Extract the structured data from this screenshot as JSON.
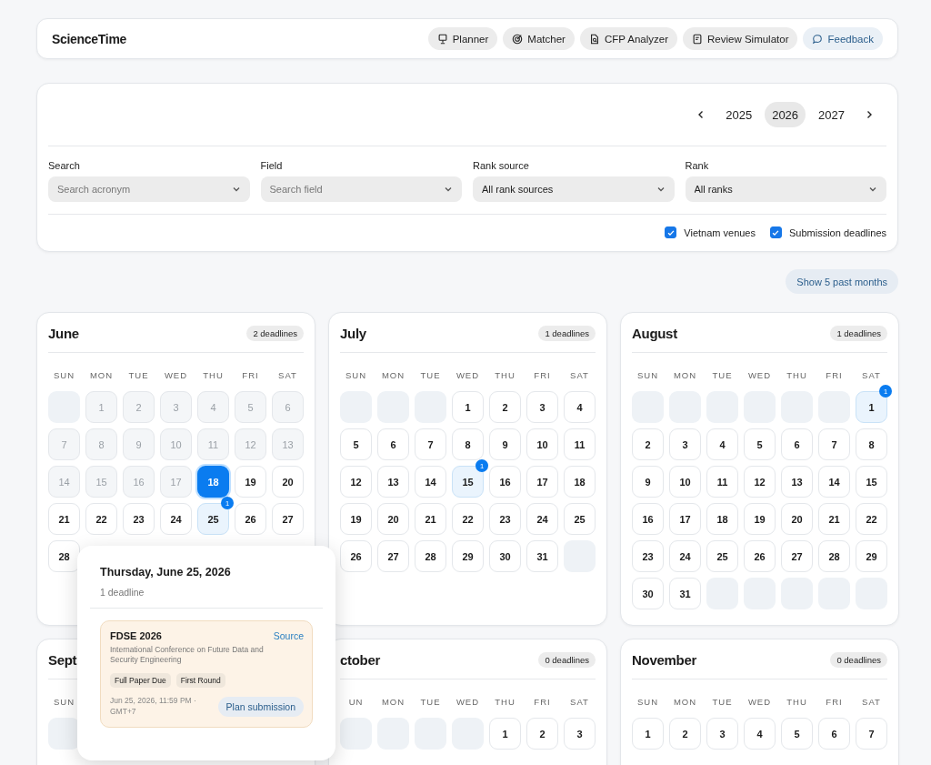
{
  "header": {
    "brand": "ScienceTime",
    "nav": [
      {
        "label": "Planner",
        "kind": "plain"
      },
      {
        "label": "Matcher",
        "kind": "plain"
      },
      {
        "label": "CFP Analyzer",
        "kind": "plain"
      },
      {
        "label": "Review Simulator",
        "kind": "plain"
      },
      {
        "label": "Feedback",
        "kind": "accent"
      }
    ]
  },
  "years": [
    {
      "label": "2025",
      "selected": false
    },
    {
      "label": "2026",
      "selected": true
    },
    {
      "label": "2027",
      "selected": false
    }
  ],
  "filters": [
    {
      "label": "Search",
      "placeholder": "Search acronym"
    },
    {
      "label": "Field",
      "placeholder": "Search field"
    },
    {
      "label": "Rank source",
      "value": "All rank sources"
    },
    {
      "label": "Rank",
      "value": "All ranks"
    }
  ],
  "toggles": [
    {
      "label": "Vietnam venues",
      "checked": true
    },
    {
      "label": "Submission deadlines",
      "checked": true
    }
  ],
  "past_button": "Show 5 past months",
  "months": [
    {
      "name": "June",
      "count": "2 deadlines",
      "weekdays": [
        "SUN",
        "MON",
        "TUE",
        "WED",
        "THU",
        "FRI",
        "SAT"
      ],
      "weeks": [
        [
          {
            "kind": "blank"
          },
          {
            "kind": "past",
            "day": "1"
          },
          {
            "kind": "past",
            "day": "2"
          },
          {
            "kind": "past",
            "day": "3"
          },
          {
            "kind": "past",
            "day": "4"
          },
          {
            "kind": "past",
            "day": "5"
          },
          {
            "kind": "past",
            "day": "6"
          }
        ],
        [
          {
            "kind": "past",
            "day": "7"
          },
          {
            "kind": "past",
            "day": "8"
          },
          {
            "kind": "past",
            "day": "9"
          },
          {
            "kind": "past",
            "day": "10"
          },
          {
            "kind": "past",
            "day": "11"
          },
          {
            "kind": "past",
            "day": "12"
          },
          {
            "kind": "past",
            "day": "13"
          }
        ],
        [
          {
            "kind": "past",
            "day": "14"
          },
          {
            "kind": "past",
            "day": "15"
          },
          {
            "kind": "past",
            "day": "16"
          },
          {
            "kind": "past",
            "day": "17"
          },
          {
            "kind": "today",
            "day": "18"
          },
          {
            "kind": "day",
            "day": "19"
          },
          {
            "kind": "day",
            "day": "20"
          }
        ],
        [
          {
            "kind": "day",
            "day": "21"
          },
          {
            "kind": "day",
            "day": "22"
          },
          {
            "kind": "day",
            "day": "23"
          },
          {
            "kind": "day",
            "day": "24"
          },
          {
            "kind": "deadline",
            "day": "25",
            "badge": "1"
          },
          {
            "kind": "day",
            "day": "26"
          },
          {
            "kind": "day",
            "day": "27"
          }
        ],
        [
          {
            "kind": "day",
            "day": "28"
          }
        ]
      ]
    },
    {
      "name": "July",
      "count": "1 deadlines",
      "weekdays": [
        "SUN",
        "MON",
        "TUE",
        "WED",
        "THU",
        "FRI",
        "SAT"
      ],
      "weeks": [
        [
          {
            "kind": "blank"
          },
          {
            "kind": "blank"
          },
          {
            "kind": "blank"
          },
          {
            "kind": "day",
            "day": "1"
          },
          {
            "kind": "day",
            "day": "2"
          },
          {
            "kind": "day",
            "day": "3"
          },
          {
            "kind": "day",
            "day": "4"
          }
        ],
        [
          {
            "kind": "day",
            "day": "5"
          },
          {
            "kind": "day",
            "day": "6"
          },
          {
            "kind": "day",
            "day": "7"
          },
          {
            "kind": "day",
            "day": "8"
          },
          {
            "kind": "day",
            "day": "9"
          },
          {
            "kind": "day",
            "day": "10"
          },
          {
            "kind": "day",
            "day": "11"
          }
        ],
        [
          {
            "kind": "day",
            "day": "12"
          },
          {
            "kind": "day",
            "day": "13"
          },
          {
            "kind": "day",
            "day": "14"
          },
          {
            "kind": "deadline",
            "day": "15",
            "badge": "1"
          },
          {
            "kind": "day",
            "day": "16"
          },
          {
            "kind": "day",
            "day": "17"
          },
          {
            "kind": "day",
            "day": "18"
          }
        ],
        [
          {
            "kind": "day",
            "day": "19"
          },
          {
            "kind": "day",
            "day": "20"
          },
          {
            "kind": "day",
            "day": "21"
          },
          {
            "kind": "day",
            "day": "22"
          },
          {
            "kind": "day",
            "day": "23"
          },
          {
            "kind": "day",
            "day": "24"
          },
          {
            "kind": "day",
            "day": "25"
          }
        ],
        [
          {
            "kind": "day",
            "day": "26"
          },
          {
            "kind": "day",
            "day": "27"
          },
          {
            "kind": "day",
            "day": "28"
          },
          {
            "kind": "day",
            "day": "29"
          },
          {
            "kind": "day",
            "day": "30"
          },
          {
            "kind": "day",
            "day": "31"
          },
          {
            "kind": "blank"
          }
        ]
      ]
    },
    {
      "name": "August",
      "count": "1 deadlines",
      "weekdays": [
        "SUN",
        "MON",
        "TUE",
        "WED",
        "THU",
        "FRI",
        "SAT"
      ],
      "weeks": [
        [
          {
            "kind": "blank"
          },
          {
            "kind": "blank"
          },
          {
            "kind": "blank"
          },
          {
            "kind": "blank"
          },
          {
            "kind": "blank"
          },
          {
            "kind": "blank"
          },
          {
            "kind": "deadline",
            "day": "1",
            "badge": "1"
          }
        ],
        [
          {
            "kind": "day",
            "day": "2"
          },
          {
            "kind": "day",
            "day": "3"
          },
          {
            "kind": "day",
            "day": "4"
          },
          {
            "kind": "day",
            "day": "5"
          },
          {
            "kind": "day",
            "day": "6"
          },
          {
            "kind": "day",
            "day": "7"
          },
          {
            "kind": "day",
            "day": "8"
          }
        ],
        [
          {
            "kind": "day",
            "day": "9"
          },
          {
            "kind": "day",
            "day": "10"
          },
          {
            "kind": "day",
            "day": "11"
          },
          {
            "kind": "day",
            "day": "12"
          },
          {
            "kind": "day",
            "day": "13"
          },
          {
            "kind": "day",
            "day": "14"
          },
          {
            "kind": "day",
            "day": "15"
          }
        ],
        [
          {
            "kind": "day",
            "day": "16"
          },
          {
            "kind": "day",
            "day": "17"
          },
          {
            "kind": "day",
            "day": "18"
          },
          {
            "kind": "day",
            "day": "19"
          },
          {
            "kind": "day",
            "day": "20"
          },
          {
            "kind": "day",
            "day": "21"
          },
          {
            "kind": "day",
            "day": "22"
          }
        ],
        [
          {
            "kind": "day",
            "day": "23"
          },
          {
            "kind": "day",
            "day": "24"
          },
          {
            "kind": "day",
            "day": "25"
          },
          {
            "kind": "day",
            "day": "26"
          },
          {
            "kind": "day",
            "day": "27"
          },
          {
            "kind": "day",
            "day": "28"
          },
          {
            "kind": "day",
            "day": "29"
          }
        ],
        [
          {
            "kind": "day",
            "day": "30"
          },
          {
            "kind": "day",
            "day": "31"
          },
          {
            "kind": "blank"
          },
          {
            "kind": "blank"
          },
          {
            "kind": "blank"
          },
          {
            "kind": "blank"
          },
          {
            "kind": "blank"
          }
        ]
      ]
    },
    {
      "name": "Sept",
      "weekdays": [
        "SUN"
      ],
      "weeks": [
        [
          {
            "kind": "blank"
          }
        ]
      ]
    },
    {
      "name": "ctober",
      "count": "0 deadlines",
      "weekdays": [
        "UN",
        "MON",
        "TUE",
        "WED",
        "THU",
        "FRI",
        "SAT"
      ],
      "weeks": [
        [
          {
            "kind": "blank"
          },
          {
            "kind": "blank"
          },
          {
            "kind": "blank"
          },
          {
            "kind": "blank"
          },
          {
            "kind": "day",
            "day": "1"
          },
          {
            "kind": "day",
            "day": "2"
          },
          {
            "kind": "day",
            "day": "3"
          }
        ]
      ]
    },
    {
      "name": "November",
      "count": "0 deadlines",
      "weekdays": [
        "SUN",
        "MON",
        "TUE",
        "WED",
        "THU",
        "FRI",
        "SAT"
      ],
      "weeks": [
        [
          {
            "kind": "day",
            "day": "1"
          },
          {
            "kind": "day",
            "day": "2"
          },
          {
            "kind": "day",
            "day": "3"
          },
          {
            "kind": "day",
            "day": "4"
          },
          {
            "kind": "day",
            "day": "5"
          },
          {
            "kind": "day",
            "day": "6"
          },
          {
            "kind": "day",
            "day": "7"
          }
        ]
      ]
    }
  ],
  "popover": {
    "title": "Thursday, June 25, 2026",
    "subtitle": "1 deadline",
    "event": {
      "name": "FDSE 2026",
      "link": "Source",
      "description": "International Conference on Future Data and Security Engineering",
      "tags": [
        "Full Paper Due",
        "First Round"
      ],
      "date": "Jun 25, 2026, 11:59 PM · GMT+7",
      "button": "Plan submission"
    }
  }
}
